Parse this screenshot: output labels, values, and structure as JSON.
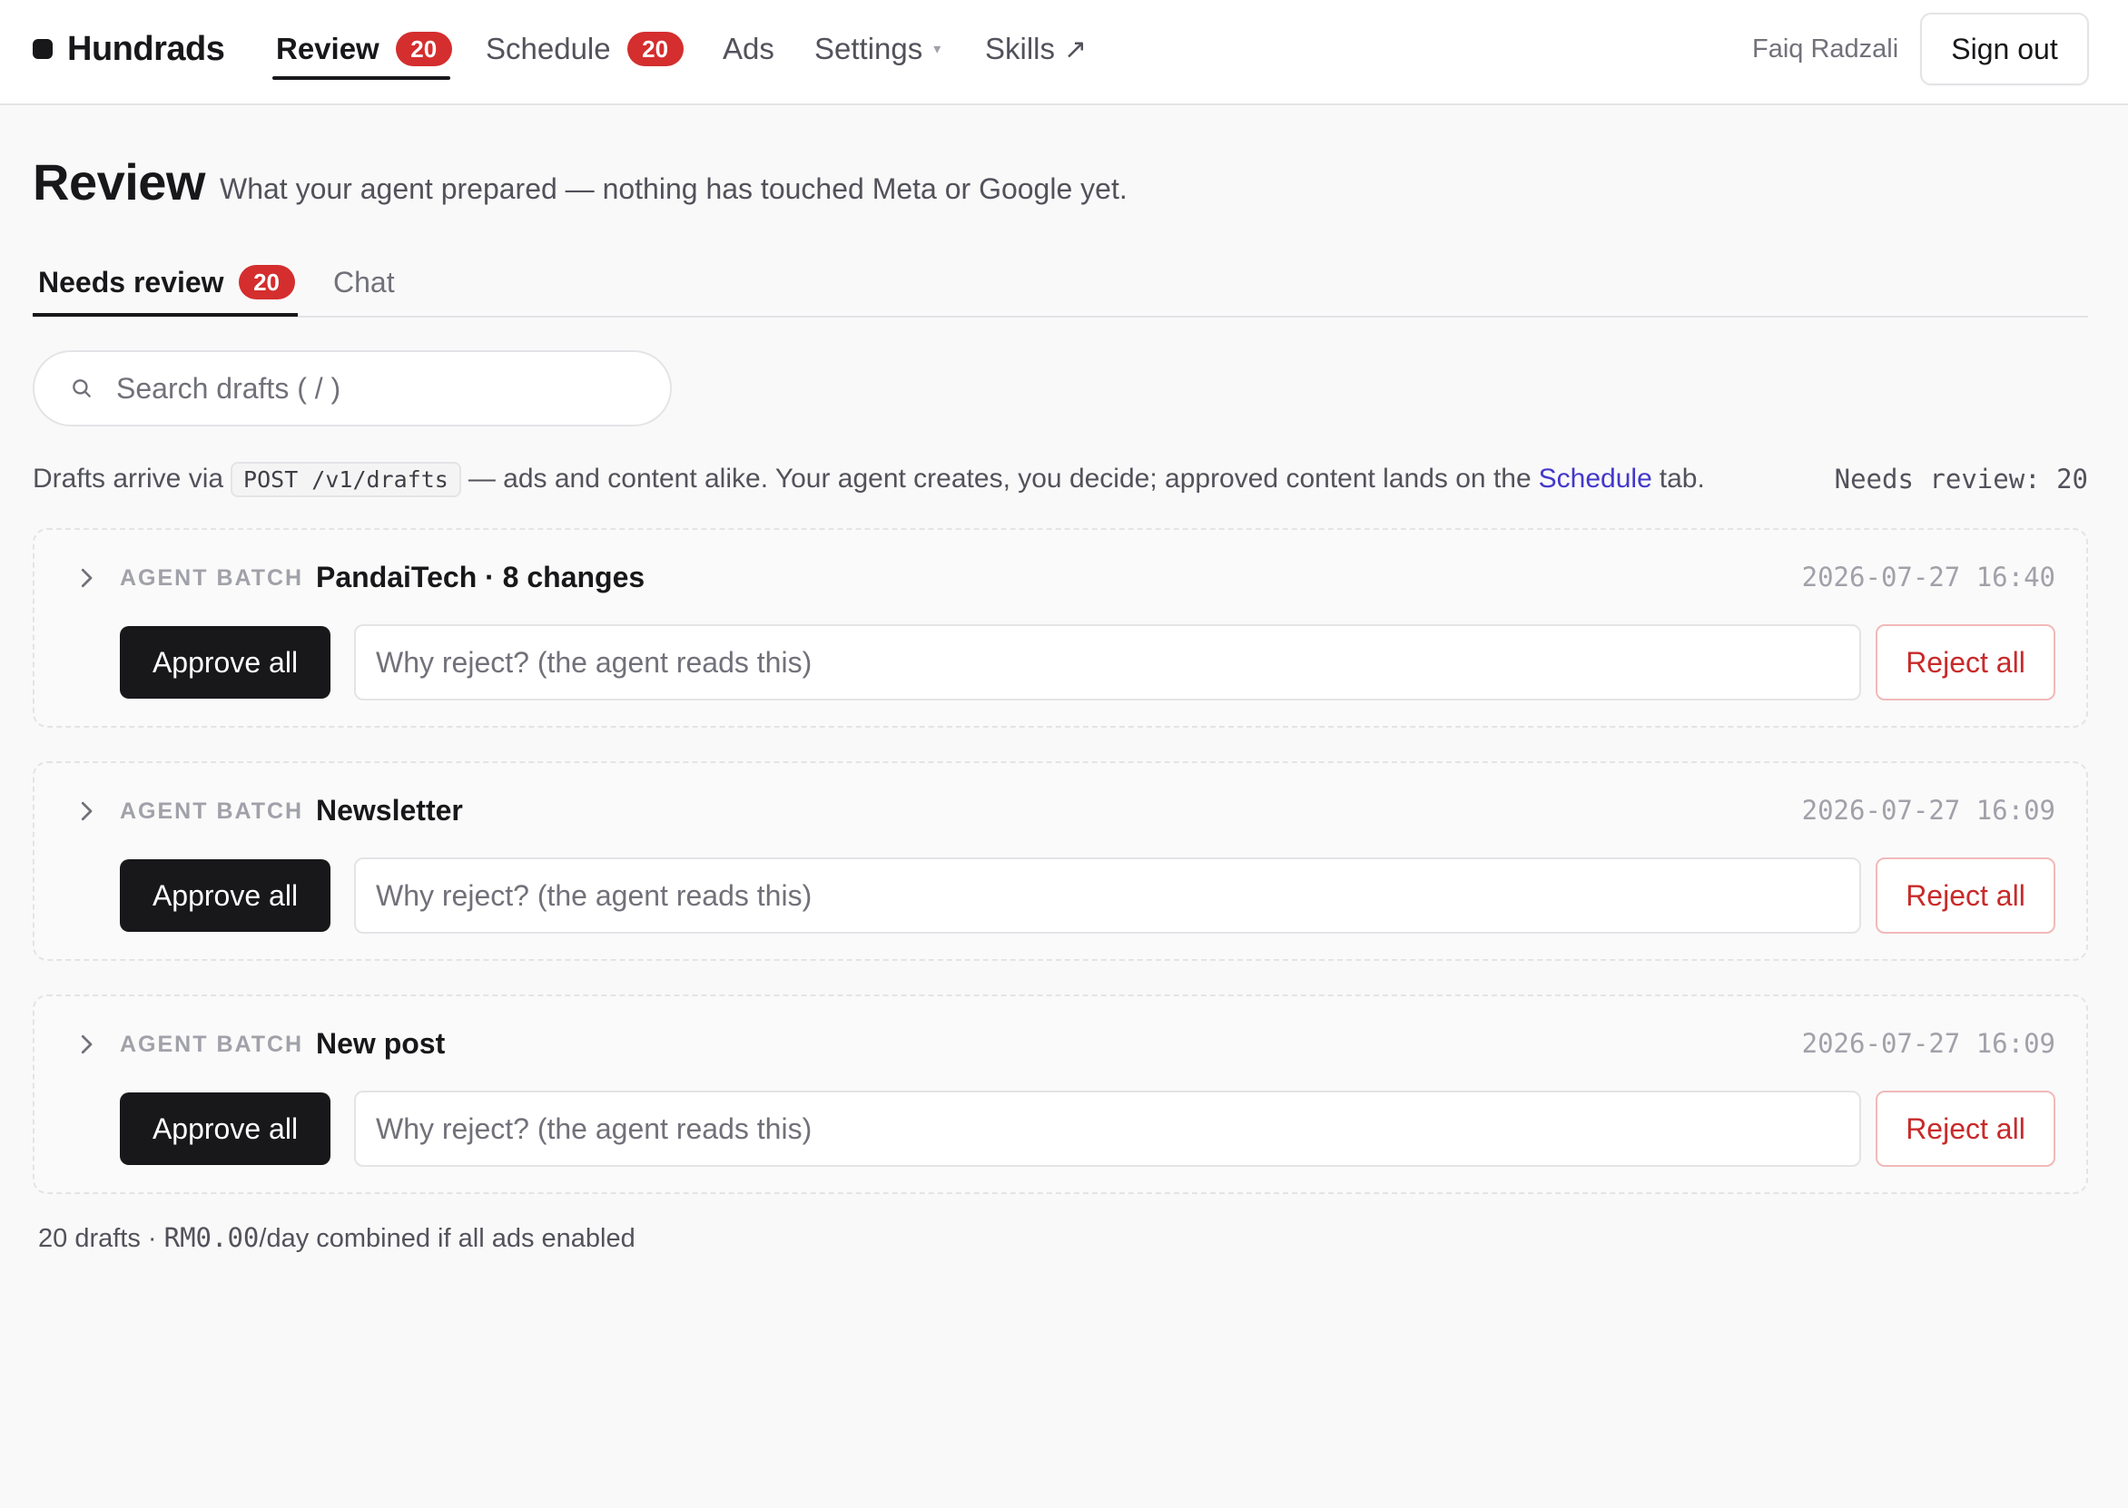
{
  "brand": {
    "name": "Hundrads"
  },
  "nav": {
    "items": [
      {
        "label": "Review",
        "badge": "20"
      },
      {
        "label": "Schedule",
        "badge": "20"
      },
      {
        "label": "Ads"
      },
      {
        "label": "Settings",
        "caret": "▾"
      },
      {
        "label": "Skills",
        "arrow": "↗"
      }
    ],
    "user": "Faiq Radzali",
    "signout": "Sign out"
  },
  "page": {
    "title": "Review",
    "subtitle": "What your agent prepared — nothing has touched Meta or Google yet."
  },
  "tabs": [
    {
      "label": "Needs review",
      "badge": "20"
    },
    {
      "label": "Chat"
    }
  ],
  "search": {
    "placeholder": "Search drafts ( / )",
    "value": ""
  },
  "info": {
    "prefix": "Drafts arrive via",
    "code": "POST /v1/drafts",
    "middle": "— ads and content alike. Your agent creates, you decide; approved content lands on the",
    "link": "Schedule",
    "suffix": "tab.",
    "needs_review": "Needs review: 20"
  },
  "batches": [
    {
      "tag": "AGENT BATCH",
      "title": "PandaiTech · 8 changes",
      "time": "2026-07-27 16:40",
      "approve": "Approve all",
      "reject_placeholder": "Why reject? (the agent reads this)",
      "reject": "Reject all"
    },
    {
      "tag": "AGENT BATCH",
      "title": "Newsletter",
      "time": "2026-07-27 16:09",
      "approve": "Approve all",
      "reject_placeholder": "Why reject? (the agent reads this)",
      "reject": "Reject all"
    },
    {
      "tag": "AGENT BATCH",
      "title": "New post",
      "time": "2026-07-27 16:09",
      "approve": "Approve all",
      "reject_placeholder": "Why reject? (the agent reads this)",
      "reject": "Reject all"
    }
  ],
  "footer": {
    "drafts": "20 drafts ·",
    "amount": "RM0.00",
    "rest": "/day combined if all ads enabled"
  },
  "colors": {
    "accent": "#18181b",
    "badge": "#d42e2e",
    "link": "#4338ca",
    "reject": "#c92a2a"
  }
}
